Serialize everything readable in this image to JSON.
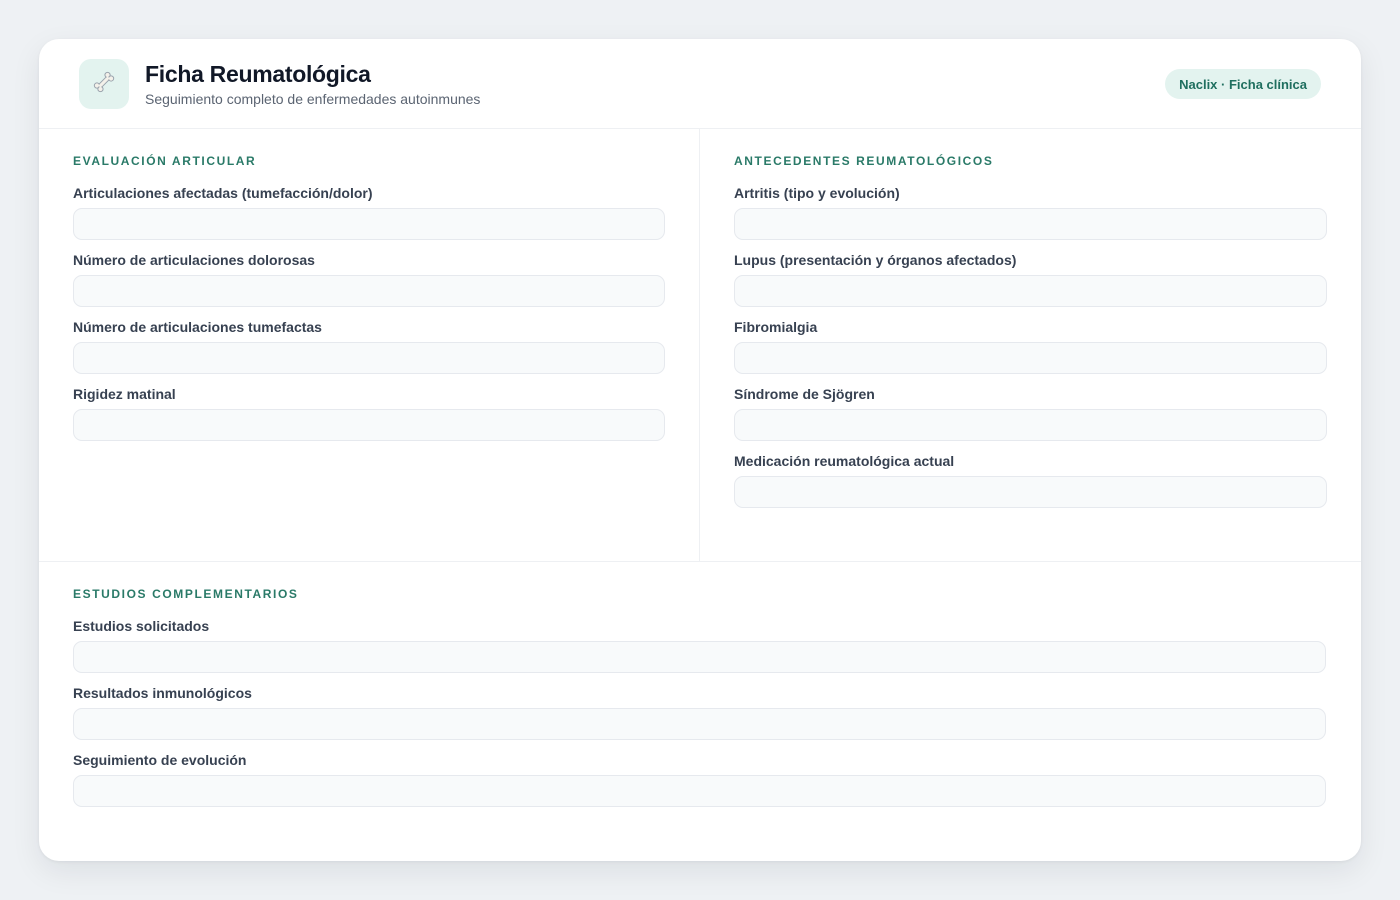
{
  "header": {
    "logo_icon": "bone-icon",
    "title": "Ficha Reumatológica",
    "subtitle": "Seguimiento completo de enfermedades autoinmunes",
    "badge": "Naclix · Ficha clínica"
  },
  "colors": {
    "accent": "#2a7a68",
    "badge_bg": "#e3f3ef",
    "input_bg": "#f8fafb",
    "page_bg": "#eef1f4"
  },
  "sections": {
    "evaluacion": {
      "title": "EVALUACIÓN ARTICULAR",
      "fields": [
        {
          "label": "Articulaciones afectadas (tumefacción/dolor)",
          "value": ""
        },
        {
          "label": "Número de articulaciones dolorosas",
          "value": ""
        },
        {
          "label": "Número de articulaciones tumefactas",
          "value": ""
        },
        {
          "label": "Rigidez matinal",
          "value": ""
        }
      ]
    },
    "antecedentes": {
      "title": "ANTECEDENTES REUMATOLÓGICOS",
      "fields": [
        {
          "label": "Artritis (tipo y evolución)",
          "value": ""
        },
        {
          "label": "Lupus (presentación y órganos afectados)",
          "value": ""
        },
        {
          "label": "Fibromialgia",
          "value": ""
        },
        {
          "label": "Síndrome de Sjögren",
          "value": ""
        },
        {
          "label": "Medicación reumatológica actual",
          "value": ""
        }
      ]
    },
    "estudios": {
      "title": "ESTUDIOS COMPLEMENTARIOS",
      "fields": [
        {
          "label": "Estudios solicitados",
          "value": ""
        },
        {
          "label": "Resultados inmunológicos",
          "value": ""
        },
        {
          "label": "Seguimiento de evolución",
          "value": ""
        }
      ]
    }
  }
}
